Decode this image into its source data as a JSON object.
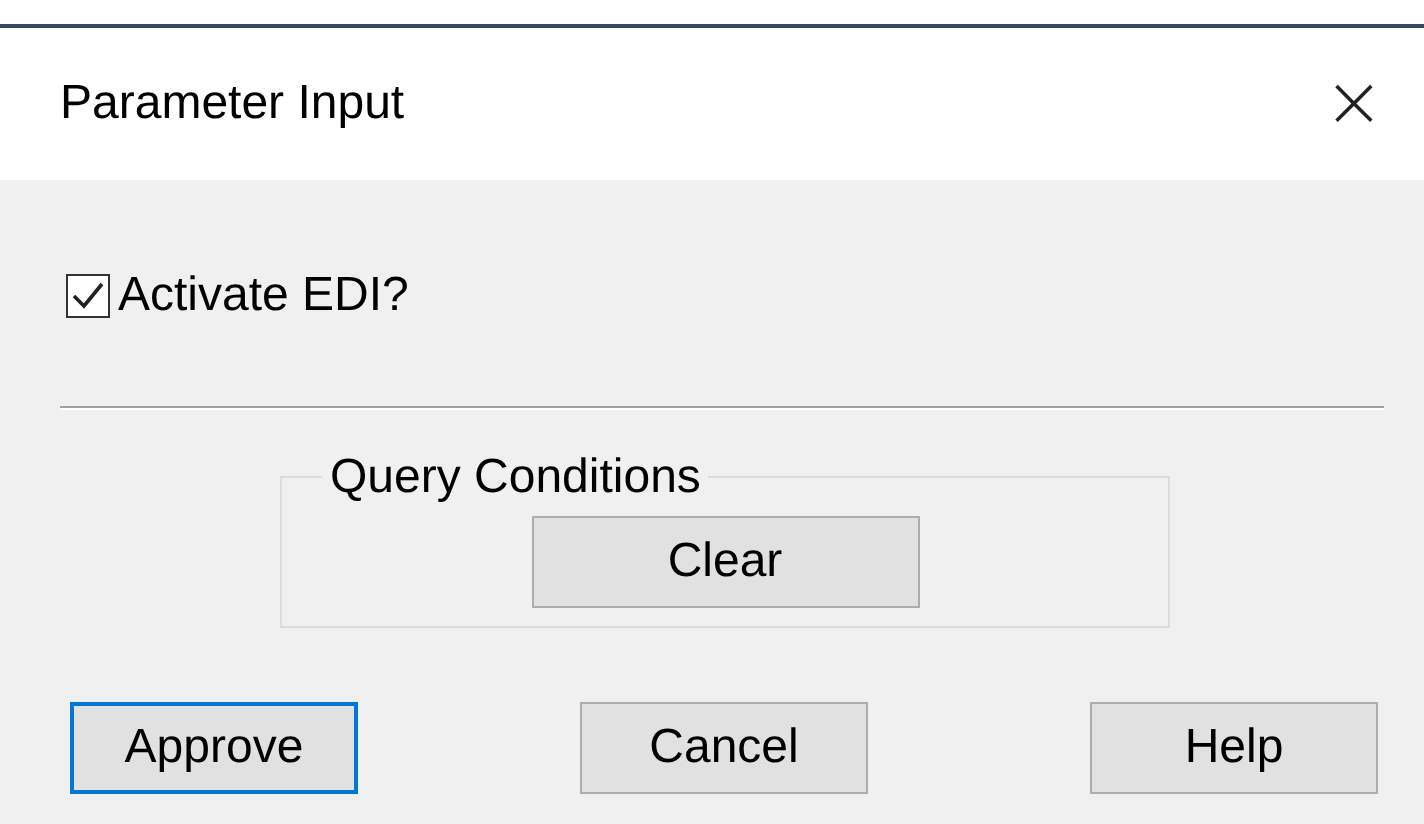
{
  "window": {
    "title": "Parameter Input",
    "close": "×"
  },
  "checkbox": {
    "label": "Activate EDI?",
    "checked": true
  },
  "group": {
    "legend": "Query Conditions",
    "button": "Clear"
  },
  "buttons": [
    {
      "label": "Approve",
      "focused": true
    },
    {
      "label": "Cancel",
      "focused": false
    },
    {
      "label": "Help",
      "focused": false
    }
  ]
}
